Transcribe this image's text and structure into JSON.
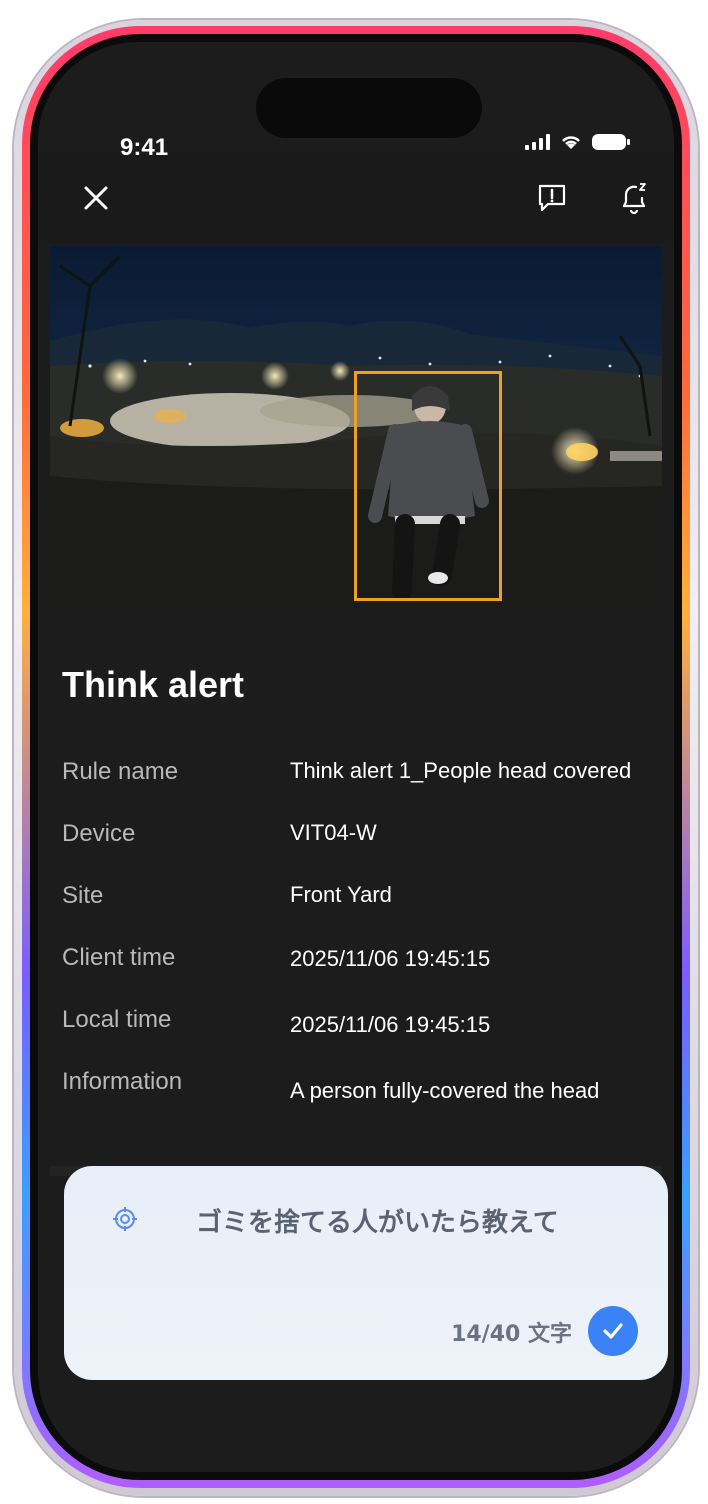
{
  "status": {
    "time": "9:41"
  },
  "alert": {
    "title": "Think alert",
    "rows": [
      {
        "label": "Rule name",
        "value": "Think alert 1_People head covered"
      },
      {
        "label": "Device",
        "value": "VIT04-W"
      },
      {
        "label": "Site",
        "value": "Front Yard"
      },
      {
        "label": "Client time",
        "value": "2025/11/06 19:45:15"
      },
      {
        "label": "Local time",
        "value": "2025/11/06 19:45:15"
      },
      {
        "label": "Information",
        "value": "A person fully-covered the head"
      }
    ]
  },
  "prompt_card": {
    "text": "ゴミを捨てる人がいたら教えて",
    "count": "14/40 文字"
  },
  "icons": {
    "close": "close-icon",
    "report": "report-icon",
    "snooze": "bell-snooze-icon",
    "target": "target-icon",
    "check": "check-icon"
  },
  "colors": {
    "screen_bg": "#1c1c1d",
    "bbox": "#f0a020",
    "accent": "#3b82f6",
    "card_bg": "#e8eef8"
  }
}
